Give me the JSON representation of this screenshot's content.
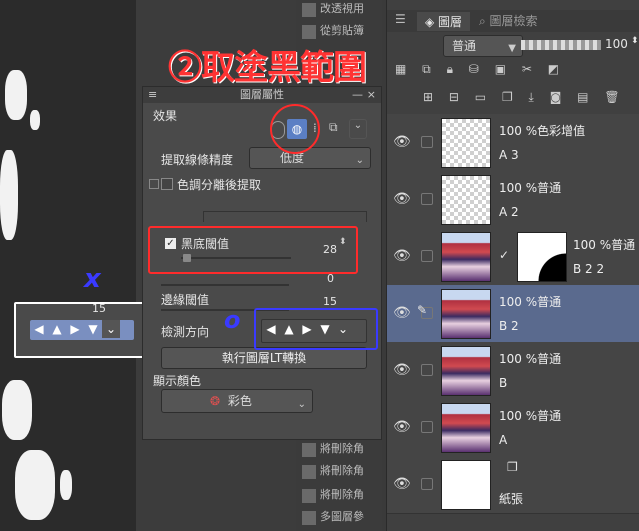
{
  "top_menu": {
    "item_top": "改透視用",
    "item_2": "從剪貼簿",
    "items_bottom": [
      "將刪除角",
      "將刪除角",
      "將刪除角",
      "多圖層參"
    ]
  },
  "layer_panel": {
    "tabs": [
      "圖層",
      "圖層檢索"
    ],
    "blend_mode": "普通",
    "opacity": "100",
    "layers": [
      {
        "title": "100 %色彩增值",
        "name": "A 3",
        "thumb": "checker",
        "selected": false,
        "mask": false
      },
      {
        "title": "100 %普通",
        "name": "A 2",
        "thumb": "checker",
        "selected": false,
        "mask": false
      },
      {
        "title": "100 %普通",
        "name": "B 2 2",
        "thumb": "photo",
        "selected": false,
        "mask": true
      },
      {
        "title": "100 %普通",
        "name": "B 2",
        "thumb": "photo",
        "selected": true,
        "mask": false
      },
      {
        "title": "100 %普通",
        "name": "B",
        "thumb": "photo",
        "selected": false,
        "mask": false
      },
      {
        "title": "100 %普通",
        "name": "A",
        "thumb": "photo",
        "selected": false,
        "mask": false
      },
      {
        "title": "",
        "name": "紙張",
        "thumb": "white",
        "selected": false,
        "mask": false
      }
    ]
  },
  "props": {
    "title": "圖層屬性",
    "effect_label": "效果",
    "extract_precision_label": "提取線條精度",
    "extract_precision_value": "低度",
    "tone_label": "色調分離後提取",
    "black_threshold_label": "黑底閾值",
    "black_threshold_value": "28",
    "white_threshold_value": "0",
    "edge_threshold_label": "邊緣閾值",
    "edge_threshold_value": "15",
    "detect_dir_label": "檢測方向",
    "execute_label": "執行圖層LT轉換",
    "display_color_label": "顯示顏色",
    "color_value": "彩色"
  },
  "left_widget": {
    "value": "15"
  },
  "annotations": {
    "title": "②取塗黑範圍",
    "mark_x": "x",
    "mark_o": "o",
    "colors": {
      "red": "#ff2b2b",
      "blue": "#3a3aff"
    }
  },
  "colors": {
    "accent": "#5a6a8e",
    "arrow_blue": "#7a8fc0"
  }
}
